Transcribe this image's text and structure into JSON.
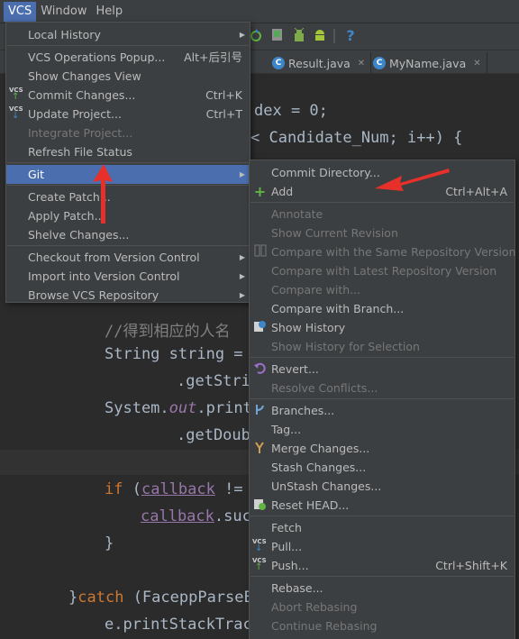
{
  "menubar": {
    "items": [
      "VCS",
      "Window",
      "Help"
    ],
    "active": "VCS"
  },
  "toolbar": {
    "help_glyph": "?"
  },
  "tabs": [
    {
      "label": "Result.java"
    },
    {
      "label": "MyName.java"
    }
  ],
  "editor": {
    "lines": [
      "dex = 0;",
      "< Candidate_Num; i++) {",
      "//得到相应的人名",
      "String string =",
      ".getStri",
      "System.",
      "out",
      ".print",
      ".getDoub",
      "if",
      "callback",
      "!=",
      "callback",
      ".suc",
      "}",
      "}",
      "catch",
      "(FaceppParseE",
      "e.printStackTrac"
    ]
  },
  "vcs_menu": {
    "items": [
      {
        "label": "Local History",
        "arrow": true
      },
      {
        "label": "VCS Operations Popup...",
        "shortcut": "Alt+后引号"
      },
      {
        "label": "Show Changes View"
      },
      {
        "label": "Commit Changes...",
        "shortcut": "Ctrl+K",
        "icon": "commit-icon"
      },
      {
        "label": "Update Project...",
        "shortcut": "Ctrl+T",
        "icon": "update-icon"
      },
      {
        "label": "Integrate Project...",
        "disabled": true
      },
      {
        "label": "Refresh File Status"
      },
      {
        "label": "Git",
        "arrow": true,
        "selected": true
      },
      {
        "label": "Create Patch..."
      },
      {
        "label": "Apply Patch..."
      },
      {
        "label": "Shelve Changes..."
      },
      {
        "label": "Checkout from Version Control",
        "arrow": true
      },
      {
        "label": "Import into Version Control",
        "arrow": true
      },
      {
        "label": "Browse VCS Repository",
        "arrow": true
      }
    ]
  },
  "git_menu": {
    "items": [
      {
        "label": "Commit Directory..."
      },
      {
        "label": "Add",
        "shortcut": "Ctrl+Alt+A",
        "icon": "plus-icon"
      },
      {
        "label": "Annotate",
        "disabled": true
      },
      {
        "label": "Show Current Revision",
        "disabled": true
      },
      {
        "label": "Compare with the Same Repository Version",
        "disabled": true,
        "icon": "compare-icon"
      },
      {
        "label": "Compare with Latest Repository Version",
        "disabled": true
      },
      {
        "label": "Compare with...",
        "disabled": true
      },
      {
        "label": "Compare with Branch..."
      },
      {
        "label": "Show History",
        "icon": "history-icon"
      },
      {
        "label": "Show History for Selection",
        "disabled": true
      },
      {
        "label": "Revert...",
        "icon": "revert-icon"
      },
      {
        "label": "Resolve Conflicts...",
        "disabled": true
      },
      {
        "label": "Branches...",
        "icon": "branch-icon"
      },
      {
        "label": "Tag..."
      },
      {
        "label": "Merge Changes...",
        "icon": "merge-icon"
      },
      {
        "label": "Stash Changes..."
      },
      {
        "label": "UnStash Changes..."
      },
      {
        "label": "Reset HEAD...",
        "icon": "reset-icon"
      },
      {
        "label": "Fetch"
      },
      {
        "label": "Pull...",
        "icon": "pull-icon"
      },
      {
        "label": "Push...",
        "shortcut": "Ctrl+Shift+K",
        "icon": "push-icon"
      },
      {
        "label": "Rebase..."
      },
      {
        "label": "Abort Rebasing",
        "disabled": true
      },
      {
        "label": "Continue Rebasing",
        "disabled": true
      }
    ]
  },
  "vcs_badge": "VCS",
  "colors": {
    "selection": "#4b6eaf",
    "annotation_arrow": "#e8302a",
    "menu_bg": "#3c3f41"
  }
}
